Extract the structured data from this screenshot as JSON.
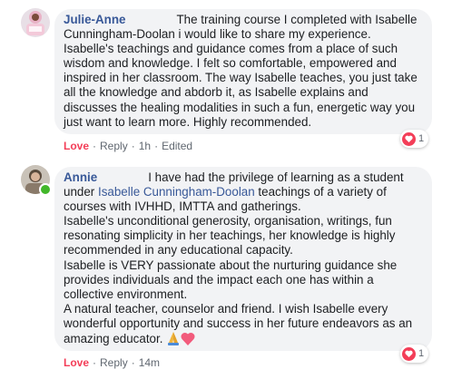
{
  "comments": [
    {
      "author": "Julie-Anne",
      "text": "The training course I completed with Isabelle Cunningham-Doolan i would like to share my experience. Isabelle's teachings and guidance comes from a place of such wisdom and knowledge. I felt so comfortable, empowered and inspired in her classroom. The way Isabelle teaches, you just take all the knowledge and abdorb it, as Isabelle explains and discusses the healing modalities in such a fun, energetic way you just want to learn more. Highly recommended.",
      "actions": {
        "love": "Love",
        "reply": "Reply",
        "time": "1h",
        "edited": "Edited"
      },
      "reaction_count": "1"
    },
    {
      "author": "Annie",
      "text_before_link": "I have had the privilege of learning as a student under",
      "mention": "Isabelle Cunningham-Doolan",
      "text_after_link": "teachings of a variety of courses with IVHHD, IMTTA and gatherings.",
      "para2": "Isabelle's unconditional generosity, organisation, writings, fun resonating simplicity in her teachings, her knowledge is highly recommended in any educational capacity.",
      "para3": "Isabelle is VERY passionate about the nurturing guidance she provides individuals and the impact each one has within a collective environment.",
      "para4": "A natural teacher, counselor and friend. I wish Isabelle every wonderful opportunity and success in her future endeavors as an amazing educator.",
      "emojis": [
        "praying-hands",
        "heart"
      ],
      "actions": {
        "love": "Love",
        "reply": "Reply",
        "time": "14m"
      },
      "reaction_count": "1"
    }
  ],
  "colors": {
    "link": "#385898",
    "love": "#f33e58",
    "bubble": "#f2f3f5",
    "meta": "#606770"
  }
}
